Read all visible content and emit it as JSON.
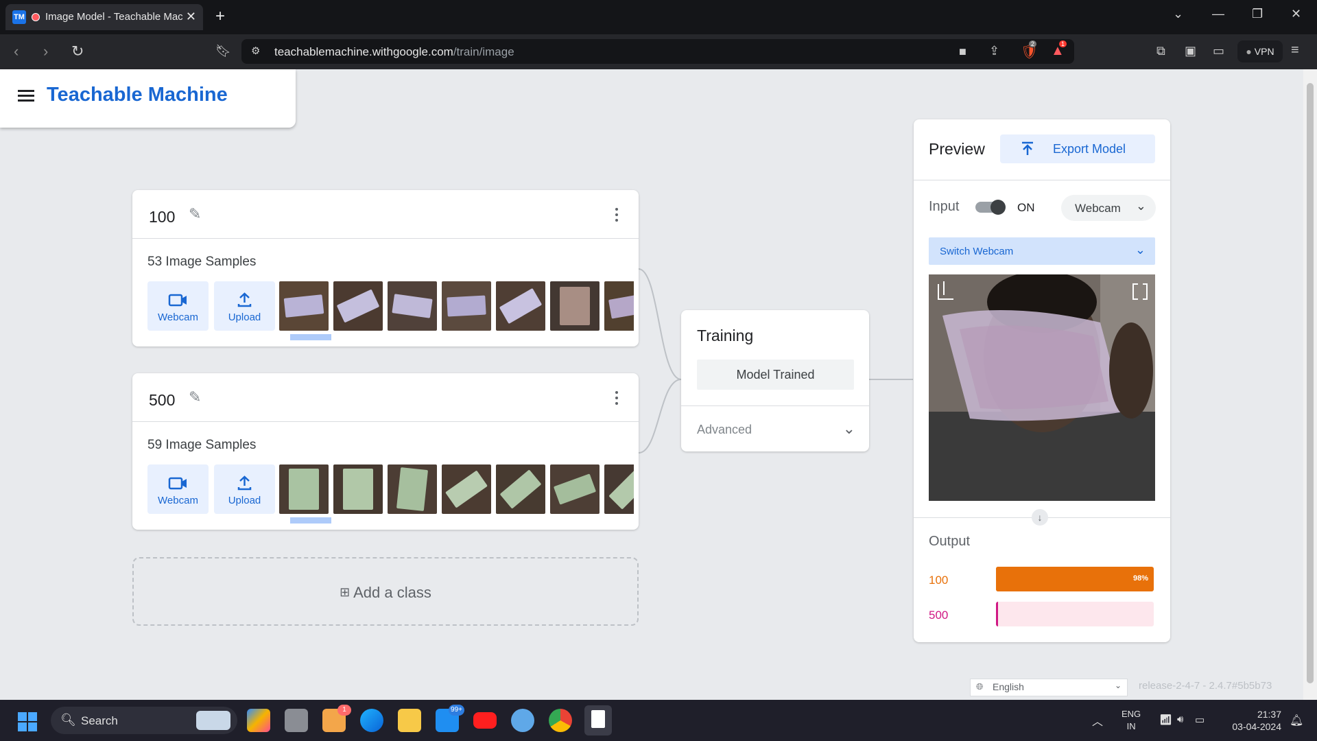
{
  "browser": {
    "tab_title": "Image Model - Teachable Machine",
    "tab_favicon": "TM",
    "url_host": "teachablemachine.withgoogle.com",
    "url_path": "/train/image",
    "vpn_label": "VPN",
    "brave_badge": "2",
    "alert_badge": "1"
  },
  "app": {
    "title": "Teachable Machine"
  },
  "classes": [
    {
      "name": "100",
      "samples": "53 Image Samples",
      "webcam_label": "Webcam",
      "upload_label": "Upload"
    },
    {
      "name": "500",
      "samples": "59 Image Samples",
      "webcam_label": "Webcam",
      "upload_label": "Upload"
    }
  ],
  "add_class_label": "Add a class",
  "training": {
    "title": "Training",
    "status": "Model Trained",
    "advanced_label": "Advanced"
  },
  "preview": {
    "title": "Preview",
    "export_label": "Export Model",
    "input_label": "Input",
    "toggle_state": "ON",
    "input_source": "Webcam",
    "switch_webcam_label": "Switch Webcam",
    "output_title": "Output",
    "outputs": [
      {
        "label": "100",
        "percent_text": "98%",
        "value": 0.98,
        "color": "#e8710a",
        "track_color": "#e8710a"
      },
      {
        "label": "500",
        "percent_text": "",
        "value": 0.01,
        "color": "#d01884",
        "track_color": "#fde7ed"
      }
    ]
  },
  "footer": {
    "language": "English",
    "release": "release-2-4-7 - 2.4.7#5b5b73"
  },
  "taskbar": {
    "search_label": "Search",
    "mail_badge": "99+",
    "app_badge": "1",
    "lang_line1": "ENG",
    "lang_line2": "IN",
    "time": "21:37",
    "date": "03-04-2024"
  },
  "colors": {
    "accent": "#1967d2",
    "class_100": "#e8710a",
    "class_500": "#d01884"
  }
}
